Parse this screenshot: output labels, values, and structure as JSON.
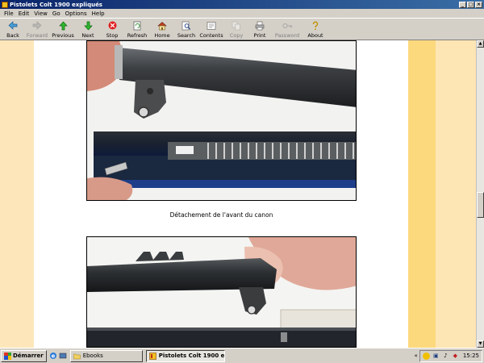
{
  "window": {
    "title": "Pistolets Colt 1900 expliqués"
  },
  "menu": [
    "File",
    "Edit",
    "View",
    "Go",
    "Options",
    "Help"
  ],
  "toolbar": [
    {
      "label": "Back",
      "icon": "back-arrow-icon",
      "enabled": true
    },
    {
      "label": "Forward",
      "icon": "forward-arrow-icon",
      "enabled": false
    },
    {
      "label": "Previous",
      "icon": "previous-icon",
      "enabled": true
    },
    {
      "label": "Next",
      "icon": "next-icon",
      "enabled": true
    },
    {
      "label": "Stop",
      "icon": "stop-icon",
      "enabled": true
    },
    {
      "label": "Refresh",
      "icon": "refresh-icon",
      "enabled": true
    },
    {
      "label": "Home",
      "icon": "home-icon",
      "enabled": true
    },
    {
      "label": "Search",
      "icon": "search-icon",
      "enabled": true
    },
    {
      "label": "Contents",
      "icon": "contents-icon",
      "enabled": true
    },
    {
      "label": "Copy",
      "icon": "copy-icon",
      "enabled": false
    },
    {
      "label": "Print",
      "icon": "print-icon",
      "enabled": true
    },
    {
      "label": "Password",
      "icon": "key-icon",
      "enabled": false
    },
    {
      "label": "About",
      "icon": "about-icon",
      "enabled": true
    }
  ],
  "document": {
    "caption": "Détachement de l'avant du canon"
  },
  "taskbar": {
    "start_label": "Démarrer",
    "tasks": [
      {
        "label": "Ebooks",
        "active": false
      },
      {
        "label": "Pistolets Colt 1900 ex...",
        "active": true
      }
    ],
    "clock": "15:25"
  },
  "colors": {
    "page_bg": "#ffffff",
    "left_stripe": "#fde7ba",
    "right_stripe": "#fdd97e",
    "titlebar": "#0a246a"
  }
}
